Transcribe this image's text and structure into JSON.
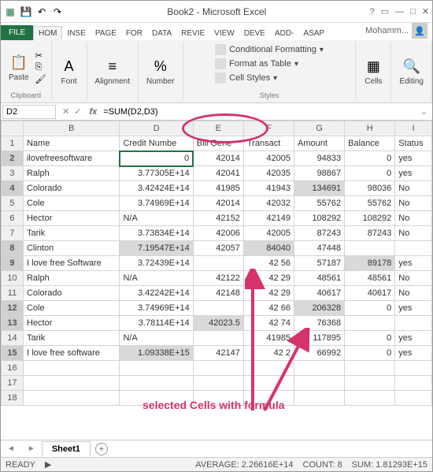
{
  "title": "Book2 - Microsoft Excel",
  "account": "Mohamm...",
  "tabs": {
    "file": "FILE",
    "home": "HOM",
    "insert": "INSE",
    "page": "PAGE",
    "formulas": "FOR",
    "data": "DATA",
    "review": "REVIE",
    "view": "VIEW",
    "developer": "DEVE",
    "addins": "ADD-",
    "asap": "ASAP"
  },
  "ribbon": {
    "clipboard": {
      "paste": "Paste",
      "label": "Clipboard"
    },
    "font": {
      "btn": "Font"
    },
    "alignment": {
      "btn": "Alignment"
    },
    "number": {
      "btn": "Number"
    },
    "styles": {
      "cond": "Conditional Formatting",
      "table": "Format as Table",
      "cell": "Cell Styles",
      "label": "Styles"
    },
    "cells": {
      "btn": "Cells"
    },
    "editing": {
      "btn": "Editing"
    }
  },
  "namebox": "D2",
  "formula": "=SUM(D2,D3)",
  "cols": [
    "",
    "B",
    "D",
    "E",
    "F",
    "G",
    "H",
    "I"
  ],
  "headers": {
    "B": "Name",
    "D": "Credit Numbe",
    "E": "Bill Gene",
    "F": "Transact",
    "G": "Amount",
    "H": "Balance",
    "I": "Status"
  },
  "rows": [
    {
      "n": 1,
      "hdr": true
    },
    {
      "n": 2,
      "B": "ilovefreesoftware",
      "D": "0",
      "E": "42014",
      "F": "42005",
      "G": "94833",
      "H": "0",
      "I": "yes",
      "active": true,
      "selRow": true
    },
    {
      "n": 3,
      "B": "Ralph",
      "D": "3.77305E+14",
      "E": "42041",
      "F": "42035",
      "G": "98867",
      "H": "0",
      "I": "yes"
    },
    {
      "n": 4,
      "B": "Colorado",
      "D": "3.42424E+14",
      "E": "41985",
      "F": "41943",
      "G": "134691",
      "H": "98036",
      "I": "No",
      "selRow": true,
      "selG": true
    },
    {
      "n": 5,
      "B": "Cole",
      "D": "3.74969E+14",
      "E": "42014",
      "F": "42032",
      "G": "55762",
      "H": "55762",
      "I": "No"
    },
    {
      "n": 6,
      "B": "Hector",
      "D": "N/A",
      "E": "42152",
      "F": "42149",
      "G": "108292",
      "H": "108292",
      "I": "No"
    },
    {
      "n": 7,
      "B": "Tarik",
      "D": "3.73834E+14",
      "E": "42006",
      "F": "42005",
      "G": "87243",
      "H": "87243",
      "I": "No"
    },
    {
      "n": 8,
      "B": "Clinton",
      "D": "7.19547E+14",
      "E": "42057",
      "F": "84040",
      "G": "47448",
      "H": "",
      "I": "",
      "selRow": true,
      "selD": true,
      "selF": true
    },
    {
      "n": 9,
      "B": "I love free Software",
      "D": "3.72439E+14",
      "E": "",
      "F": "42 56",
      "G": "57187",
      "H": "89178",
      "I": "yes",
      "selRow": true,
      "selH": true
    },
    {
      "n": 10,
      "B": "Ralph",
      "D": "N/A",
      "E": "42122",
      "F": "42 29",
      "G": "48561",
      "H": "48561",
      "I": "No"
    },
    {
      "n": 11,
      "B": "Colorado",
      "D": "3.42242E+14",
      "E": "42148",
      "F": "42 29",
      "G": "40617",
      "H": "40617",
      "I": "No"
    },
    {
      "n": 12,
      "B": "Cole",
      "D": "3.74969E+14",
      "E": "",
      "F": "42 66",
      "G": "206328",
      "H": "0",
      "I": "yes",
      "selRow": true,
      "selG": true
    },
    {
      "n": 13,
      "B": "Hector",
      "D": "3.78114E+14",
      "E": "42023.5",
      "F": "42 74",
      "G": " 76368",
      "H": "",
      "I": "",
      "selRow": true,
      "selE": true
    },
    {
      "n": 14,
      "B": "Tarik",
      "D": "N/A",
      "E": "",
      "F": "41985",
      "G": "117895",
      "H": "0",
      "I": "yes"
    },
    {
      "n": 15,
      "B": "I love free software",
      "D": "1.09338E+15",
      "E": "42147",
      "F": "42 2",
      "G": "66992",
      "H": "0",
      "I": "yes",
      "selRow": true,
      "selD": true
    },
    {
      "n": 16
    },
    {
      "n": 17
    },
    {
      "n": 18
    }
  ],
  "annotation": "selected Cells with formula",
  "sheet": "Sheet1",
  "status": {
    "ready": "READY",
    "avg": "AVERAGE: 2.26616E+14",
    "count": "COUNT: 8",
    "sum": "SUM: 1.81293E+15"
  }
}
